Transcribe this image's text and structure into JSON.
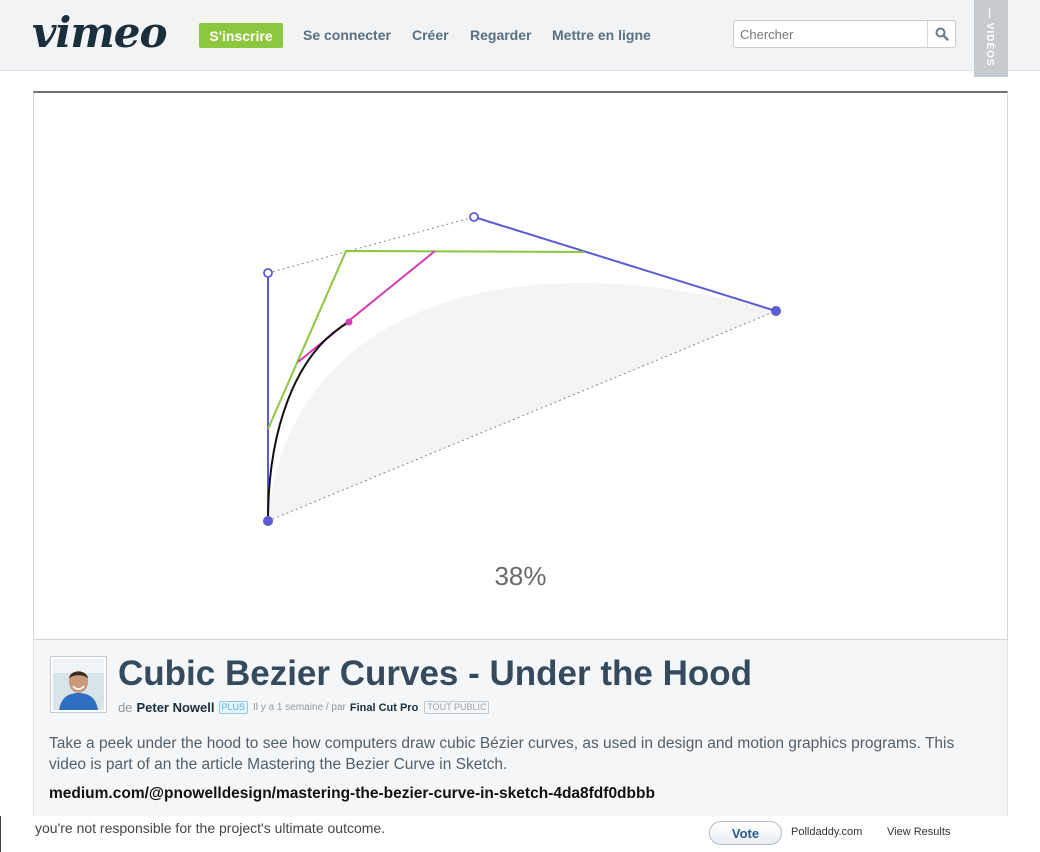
{
  "header": {
    "logo": "vimeo",
    "signup_label": "S'inscrire",
    "nav": [
      "Se connecter",
      "Créer",
      "Regarder",
      "Mettre en ligne"
    ],
    "search_placeholder": "Chercher",
    "videos_tab": "— VIDÉOS"
  },
  "player": {
    "progress_label": "38%",
    "progress_value": 0.38
  },
  "video": {
    "title": "Cubic Bezier Curves - Under the Hood",
    "by_prefix": "de",
    "author": "Peter Nowell",
    "plus_badge": "PLUS",
    "time_ago": "Il y a 1 semaine / par",
    "channel": "Final Cut Pro",
    "rating_badge": "TOUT PUBLIC",
    "description": "Take a peek under the hood to see how computers draw cubic Bézier curves, as used in design and motion graphics programs. This video is part of an the article Mastering the Bezier Curve in Sketch.",
    "link": "medium.com/@pnowelldesign/mastering-the-bezier-curve-in-sketch-4da8fdf0dbbb"
  },
  "poll": {
    "text": "you're not responsible for the project's ultimate outcome.",
    "vote_label": "Vote",
    "provider": "Polldaddy.com",
    "results_label": "View Results"
  },
  "colors": {
    "brand_green": "#8dc63f",
    "control_line": "#5b5bd6",
    "second_level": "#8dc63f",
    "third_level": "#d63ab4",
    "title": "#354a5c"
  },
  "icons": [
    "search-icon"
  ]
}
